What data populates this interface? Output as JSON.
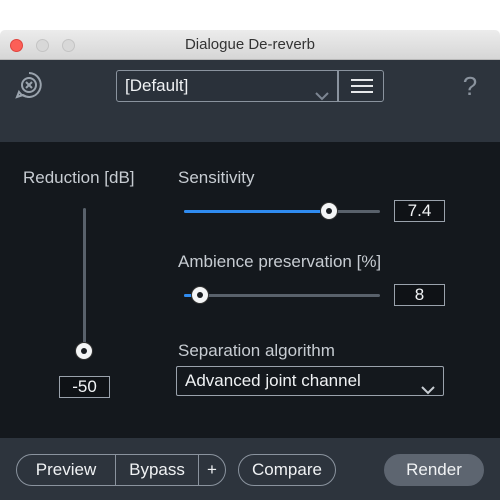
{
  "window": {
    "title": "Dialogue De-reverb"
  },
  "header": {
    "logo_icon": "module-logo-icon",
    "preset_value": "[Default]",
    "menu_icon": "hamburger-menu-icon",
    "help_label": "?"
  },
  "controls": {
    "reduction": {
      "label": "Reduction [dB]",
      "value": "-50",
      "level": 0.95
    },
    "sensitivity": {
      "label": "Sensitivity",
      "value": "7.4",
      "level": 0.74
    },
    "ambience": {
      "label": "Ambience preservation [%]",
      "value": "8",
      "level": 0.08
    },
    "algorithm": {
      "label": "Separation algorithm",
      "value": "Advanced joint channel"
    }
  },
  "footer": {
    "preview_label": "Preview",
    "bypass_label": "Bypass",
    "plus_label": "+",
    "compare_label": "Compare",
    "render_label": "Render"
  },
  "colors": {
    "accent": "#2f8bf0",
    "header_bg": "#2d343d",
    "panel_bg": "#14181d",
    "close_button": "#fc5f57"
  }
}
